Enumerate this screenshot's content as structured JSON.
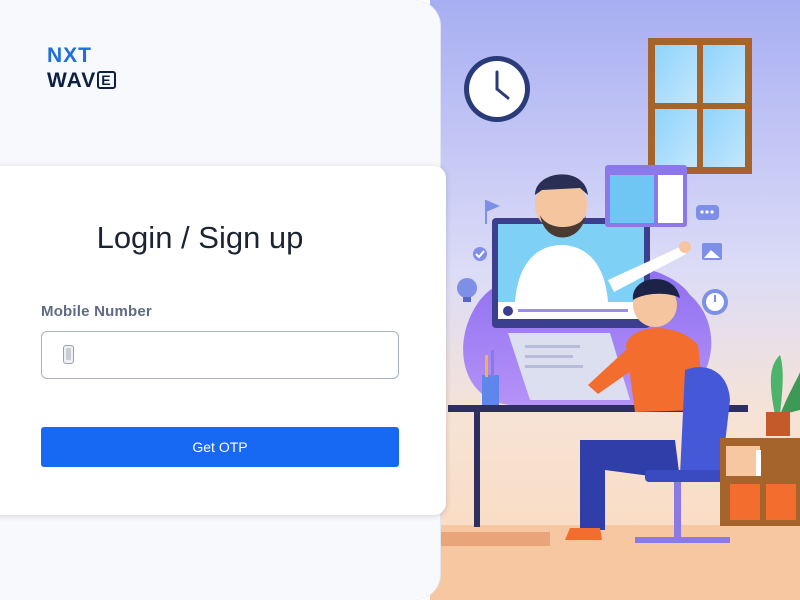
{
  "logo": {
    "line1": "NXT",
    "line2": "WAV",
    "line2_boxed": "E"
  },
  "login": {
    "title": "Login / Sign up",
    "mobile_label": "Mobile Number",
    "mobile_value": "",
    "mobile_placeholder": "",
    "submit_label": "Get OTP"
  },
  "colors": {
    "primary_button": "#1769f4",
    "logo_blue": "#1e6fd8",
    "logo_navy": "#0c1f44",
    "title_text": "#1c2433",
    "label_text": "#5f6a85"
  },
  "icons": {
    "input_icon": "mobile-phone-icon"
  }
}
